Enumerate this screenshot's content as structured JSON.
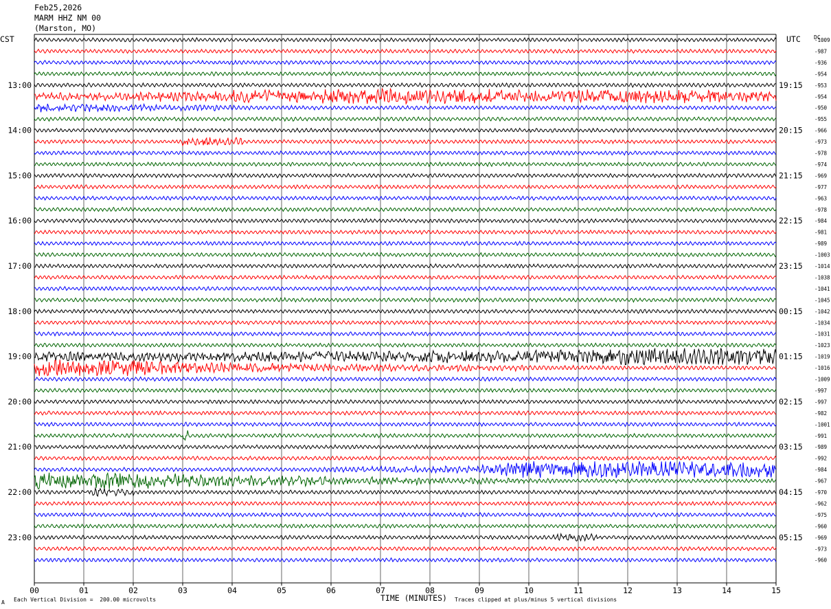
{
  "header": {
    "date": "Feb25,2026",
    "station": "MARM HHZ NM 00",
    "location": "(Marston, MO)"
  },
  "left_axis_label": "CST",
  "right_axis_label": "UTC",
  "dc_label": "DC",
  "footer": {
    "scale_note": "Each Vertical Division =  200.00 microvolts",
    "xlabel": "TIME (MINUTES)",
    "clip_note": "Traces clipped at plus/minus 5 vertical divisions",
    "corner_mark": "A"
  },
  "colors": {
    "trace_cycle": [
      "#000000",
      "#ff0000",
      "#0000ff",
      "#006400"
    ],
    "grid": "#000000"
  },
  "chart_data": {
    "type": "line",
    "title": "MARM HHZ NM 00",
    "xlabel": "TIME (MINUTES)",
    "xlim": [
      0,
      15
    ],
    "x_ticks": [
      "00",
      "01",
      "02",
      "03",
      "04",
      "05",
      "06",
      "07",
      "08",
      "09",
      "10",
      "11",
      "12",
      "13",
      "14",
      "15"
    ],
    "rows_per_hour": 4,
    "minutes_per_row": 15,
    "left_hour_labels": [
      "13:00",
      "14:00",
      "15:00",
      "16:00",
      "17:00",
      "18:00",
      "19:00",
      "20:00",
      "21:00",
      "22:00",
      "23:00"
    ],
    "right_hour_labels": [
      "19:15",
      "20:15",
      "21:15",
      "22:15",
      "23:15",
      "00:15",
      "01:15",
      "02:15",
      "03:15",
      "04:15",
      "05:15"
    ],
    "dc_offsets": [
      -1009,
      -987,
      -936,
      -954,
      -953,
      -954,
      -950,
      -955,
      -966,
      -973,
      -978,
      -974,
      -969,
      -977,
      -963,
      -978,
      -984,
      -981,
      -989,
      -1003,
      -1014,
      -1038,
      -1041,
      -1045,
      -1042,
      -1034,
      -1031,
      -1023,
      -1019,
      -1016,
      -1009,
      -997,
      -997,
      -982,
      -1001,
      -991,
      -989,
      -992,
      -984,
      -967,
      -970,
      -962,
      -975,
      -960,
      -969,
      -973,
      -960
    ],
    "events": [
      {
        "row": 5,
        "start_min": 0,
        "end_min": 15,
        "amp": [
          2.2,
          2.2,
          2.3,
          3.5,
          4.5,
          5.5,
          6,
          6,
          6,
          5,
          5,
          5.5,
          5.5,
          5.5,
          4.5,
          4
        ]
      },
      {
        "row": 6,
        "start_min": 0,
        "end_min": 15,
        "amp": [
          3.5,
          2.2,
          1.8,
          1.4,
          1.2,
          1.1,
          1,
          1,
          1,
          1,
          1,
          1,
          1,
          1,
          1,
          1
        ]
      },
      {
        "row": 9,
        "start_min": 3,
        "end_min": 4.2,
        "amp": [
          3.2,
          3,
          2.5
        ]
      },
      {
        "row": 28,
        "start_min": 0,
        "end_min": 15,
        "amp": [
          3.5,
          3,
          3,
          3.2,
          3.5,
          3.5,
          4,
          4,
          4.5,
          5,
          6,
          6,
          8,
          8,
          7,
          7
        ]
      },
      {
        "row": 29,
        "start_min": 0,
        "end_min": 15,
        "amp": [
          7,
          7,
          6.5,
          4.5,
          3.5,
          3,
          2.5,
          2,
          1.8,
          1.5,
          1.2,
          1.2,
          1,
          1,
          1,
          1
        ]
      },
      {
        "row": 35,
        "start_min": 3,
        "end_min": 3.1,
        "amp": [
          5
        ]
      },
      {
        "row": 38,
        "start_min": 0,
        "end_min": 15,
        "amp": [
          1,
          1,
          1,
          1,
          1,
          1,
          1.2,
          1.4,
          1.6,
          2.5,
          7,
          7,
          7.5,
          7,
          6.5,
          6.5
        ]
      },
      {
        "row": 39,
        "start_min": 0,
        "end_min": 15,
        "amp": [
          7,
          7,
          6.5,
          5.5,
          4.5,
          3.5,
          2.5,
          2,
          1.7,
          1.5,
          1.2,
          1,
          1,
          1,
          1,
          1
        ]
      },
      {
        "row": 40,
        "start_min": 1,
        "end_min": 2,
        "amp": [
          2.2,
          2.2
        ]
      },
      {
        "row": 44,
        "start_min": 10.5,
        "end_min": 11.5,
        "amp": [
          2.2,
          2
        ]
      }
    ],
    "grid": true
  }
}
